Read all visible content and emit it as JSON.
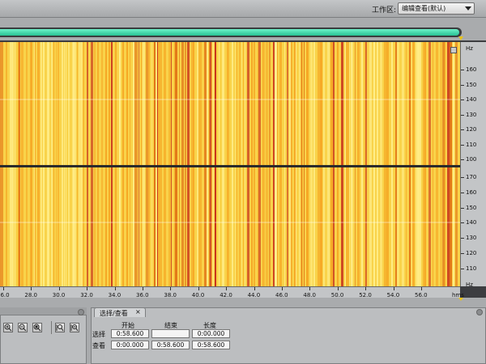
{
  "workspace": {
    "label": "工作区:",
    "selected": "编辑查看(默认)"
  },
  "spectral": {
    "colors": {
      "base": "#f9d34a",
      "light": "#ffee8a",
      "mid": "#f5a623",
      "dark": "#e07015",
      "red": "#c8321c",
      "divider": "#2b2b2b"
    },
    "frequency_unit": "Hz",
    "freq_upper_channel": [
      "160",
      "150",
      "140",
      "130",
      "120",
      "110",
      "100"
    ],
    "freq_lower_channel": [
      "170",
      "160",
      "150",
      "140",
      "130",
      "120",
      "110"
    ],
    "time_labels": [
      "26.0",
      "28.0",
      "30.0",
      "32.0",
      "34.0",
      "36.0",
      "38.0",
      "40.0",
      "42.0",
      "44.0",
      "46.0",
      "48.0",
      "50.0",
      "52.0",
      "54.0",
      "56.0"
    ],
    "time_unit": "hms"
  },
  "zoom_panel": {
    "buttons": [
      "zoom-in-amplitude-icon",
      "zoom-out-amplitude-icon",
      "zoom-in-time-icon",
      "zoom-out-time-icon",
      "zoom-to-selection-icon"
    ]
  },
  "selection_panel": {
    "tab_label": "选择/查看",
    "close_label": "×",
    "columns": {
      "start": "开始",
      "end": "结束",
      "length": "长度"
    },
    "rows": [
      {
        "label": "选择",
        "start": "0:58.600",
        "end": "",
        "length": "0:00.000"
      },
      {
        "label": "查看",
        "start": "0:00.000",
        "end": "0:58.600",
        "length": "0:58.600"
      }
    ]
  }
}
